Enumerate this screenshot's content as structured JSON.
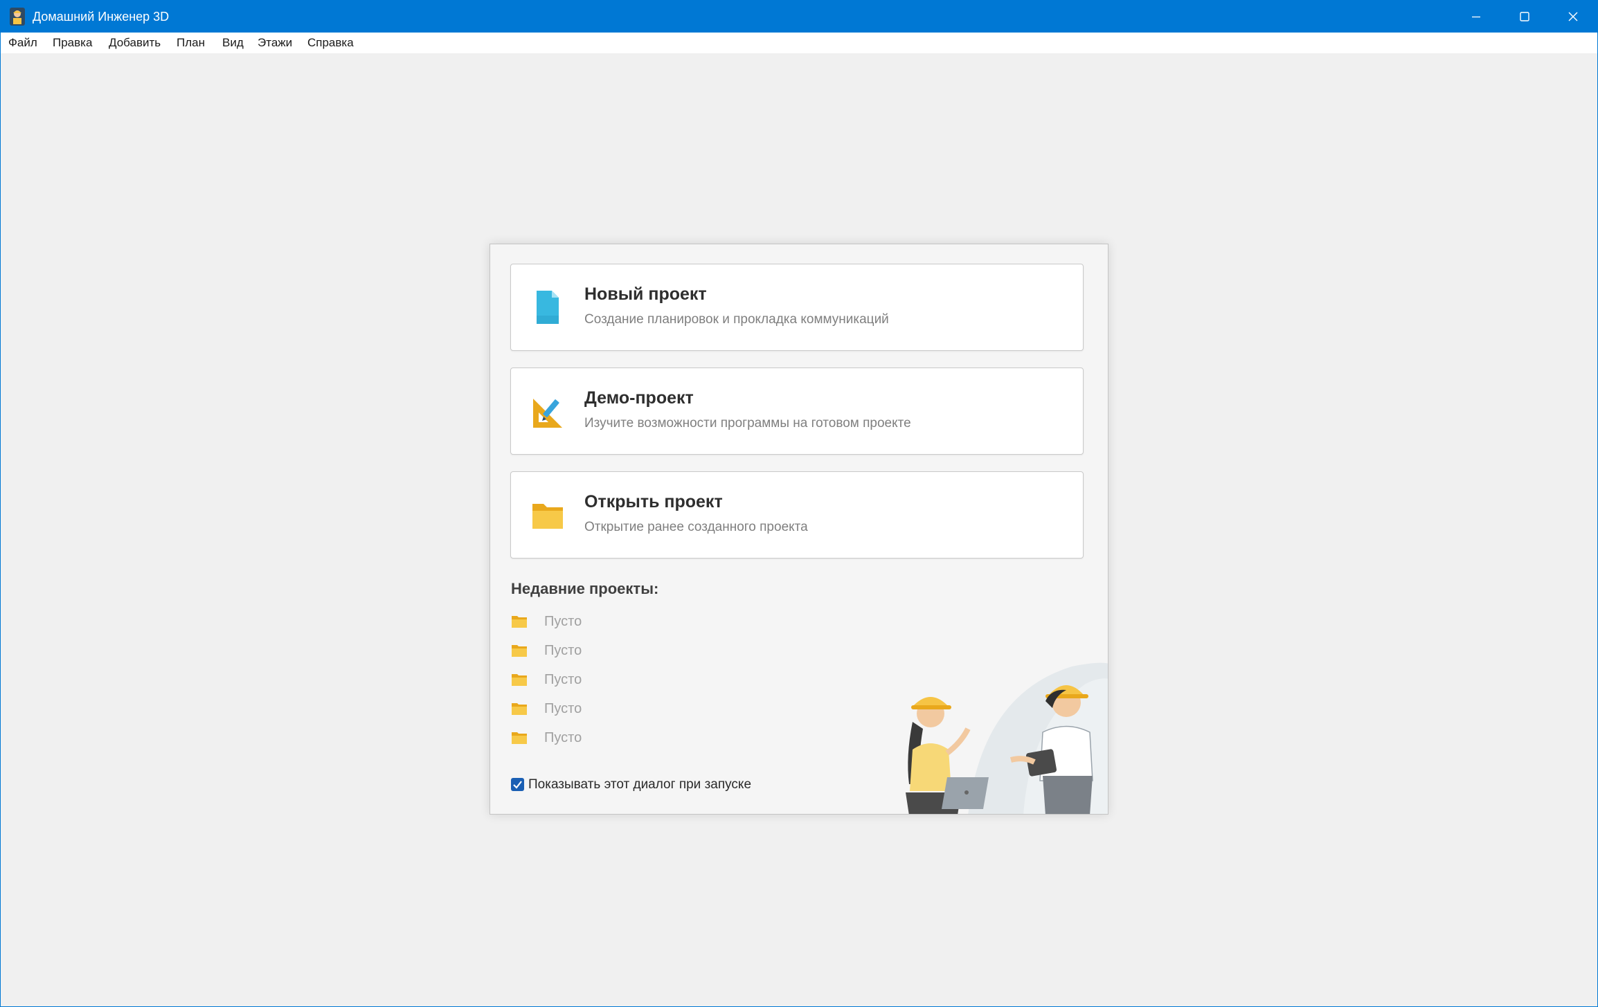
{
  "window": {
    "title": "Домашний Инженер 3D"
  },
  "menu": [
    "Файл",
    "Правка",
    "Добавить",
    "План",
    "Вид",
    "Этажи",
    "Справка"
  ],
  "cards": [
    {
      "title": "Новый проект",
      "description": "Создание планировок и прокладка коммуникаций",
      "icon": "document-icon"
    },
    {
      "title": "Демо-проект",
      "description": "Изучите возможности программы на готовом проекте",
      "icon": "ruler-pencil-icon"
    },
    {
      "title": "Открыть проект",
      "description": "Открытие ранее созданного проекта",
      "icon": "folder-icon"
    }
  ],
  "recent": {
    "title": "Недавние проекты:",
    "items": [
      "Пусто",
      "Пусто",
      "Пусто",
      "Пусто",
      "Пусто"
    ]
  },
  "startup": {
    "label": "Показывать этот диалог при запуске",
    "checked": true
  },
  "colors": {
    "titlebar": "#0078d4",
    "accent_yellow": "#f6c445",
    "icon_cyan": "#38b8e0",
    "checkbox": "#1a5fb4"
  }
}
